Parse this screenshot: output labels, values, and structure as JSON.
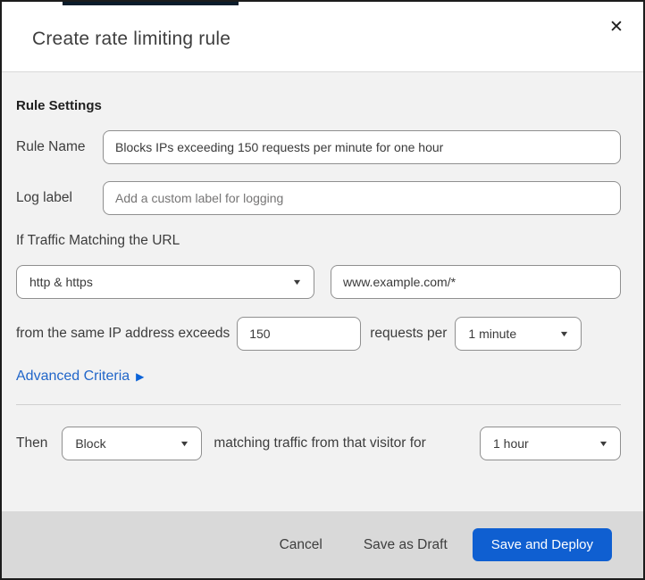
{
  "header": {
    "title": "Create rate limiting rule"
  },
  "icons": {
    "close": "✕",
    "caret": "▼",
    "expand_arrow": "▶"
  },
  "colors": {
    "primary_button_blue": "#0f5fd1",
    "link_blue": "#2166c9",
    "footer_gray": "#d9d9d9",
    "body_gray": "#f2f2f2"
  },
  "body": {
    "section_heading": "Rule Settings",
    "rule_name": {
      "label": "Rule Name",
      "value": "Blocks IPs exceeding 150 requests per minute for one hour"
    },
    "log_label": {
      "label": "Log label",
      "placeholder": "Add a custom label for logging"
    },
    "match_heading": "If Traffic Matching the URL",
    "scheme_select": {
      "value": "http & https"
    },
    "url_input": {
      "value": "www.example.com/*"
    },
    "threshold": {
      "prefix": "from the same IP address exceeds",
      "requests_value": "150",
      "unit_text": "requests per",
      "period_value": "1 minute"
    },
    "advanced_link_label": "Advanced Criteria",
    "then": {
      "label": "Then",
      "action_value": "Block",
      "middle_text": "matching traffic from that visitor for",
      "duration_value": "1 hour"
    }
  },
  "footer": {
    "cancel_label": "Cancel",
    "save_draft_label": "Save as Draft",
    "save_deploy_label": "Save and Deploy"
  }
}
